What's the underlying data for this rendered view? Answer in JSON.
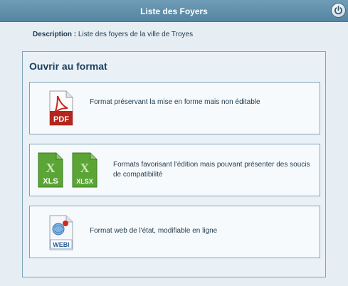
{
  "window": {
    "title": "Liste des Foyers",
    "close_icon": "power-icon"
  },
  "description": {
    "label": "Description :",
    "value": "Liste des foyers de la ville de Troyes"
  },
  "panel": {
    "title": "Ouvrir au format",
    "options": [
      {
        "id": "pdf",
        "icon": "pdf-icon",
        "icon_text": "PDF",
        "text": "Format préservant la mise en forme mais non éditable"
      },
      {
        "id": "excel",
        "icons": [
          {
            "name": "xls-icon",
            "text": "XLS"
          },
          {
            "name": "xlsx-icon",
            "text": "XLSX"
          }
        ],
        "text": "Formats favorisant l'édition mais pouvant présenter des soucis de compatibilité"
      },
      {
        "id": "webi",
        "icon": "webi-icon",
        "icon_text": "WEBI",
        "text": "Format web de l'état, modifiable en ligne"
      }
    ]
  },
  "colors": {
    "titlebar": "#5e8dab",
    "pdf_red": "#b3261e",
    "excel_green": "#4c9a2a",
    "border": "#7fa3b8"
  }
}
